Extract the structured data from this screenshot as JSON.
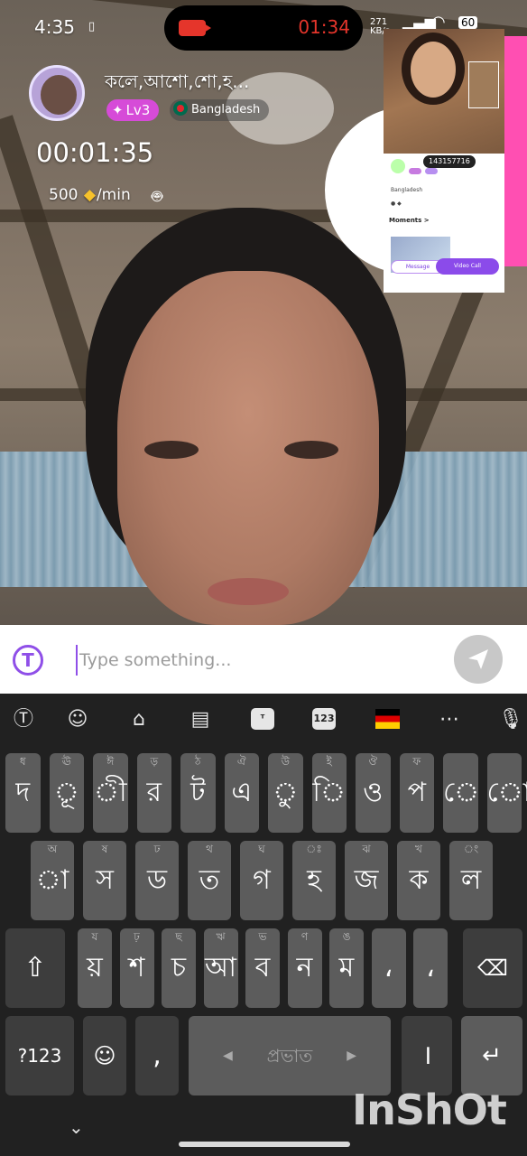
{
  "status_bar": {
    "time": "4:35",
    "network_speed": "271 KB/s",
    "battery": "60"
  },
  "call": {
    "timer": "01:34",
    "caller_name": "কলে,আশো,শো,হ...",
    "level": "Lv3",
    "country": "Bangladesh",
    "duration": "00:01:35",
    "rate_amount": "500",
    "rate_unit": "/min"
  },
  "pip": {
    "user_id": "143157716",
    "country": "Bangladesh",
    "moments_label": "Moments >",
    "message_label": "Message",
    "video_call_label": "Video Call"
  },
  "input": {
    "placeholder": "Type something..."
  },
  "keyboard": {
    "toolbar": [
      "translate-icon",
      "emoji-icon",
      "store-icon",
      "clipboard-icon",
      "theme-icon",
      "numbers-icon",
      "germany-flag-icon",
      "more-icon",
      "mic-icon"
    ],
    "row1": [
      {
        "main": "দ",
        "hint": "ধ"
      },
      {
        "main": "ূ",
        "hint": "ঊ"
      },
      {
        "main": "ী",
        "hint": "ঈ"
      },
      {
        "main": "র",
        "hint": "ড়"
      },
      {
        "main": "ট",
        "hint": "ঠ"
      },
      {
        "main": "এ",
        "hint": "ঐ"
      },
      {
        "main": "ু",
        "hint": "উ"
      },
      {
        "main": "ি",
        "hint": "ই"
      },
      {
        "main": "ও",
        "hint": "ঔ"
      },
      {
        "main": "প",
        "hint": "ফ"
      },
      {
        "main": "ে",
        "hint": ""
      },
      {
        "main": "ো",
        "hint": ""
      }
    ],
    "row2": [
      {
        "main": "া",
        "hint": "অ"
      },
      {
        "main": "স",
        "hint": "ষ"
      },
      {
        "main": "ড",
        "hint": "ঢ"
      },
      {
        "main": "ত",
        "hint": "থ"
      },
      {
        "main": "গ",
        "hint": "ঘ"
      },
      {
        "main": "হ",
        "hint": "ঃ"
      },
      {
        "main": "জ",
        "hint": "ঝ"
      },
      {
        "main": "ক",
        "hint": "খ"
      },
      {
        "main": "ল",
        "hint": "ং"
      }
    ],
    "row3": [
      {
        "main": "য়",
        "hint": "য"
      },
      {
        "main": "শ",
        "hint": "ঢ়"
      },
      {
        "main": "চ",
        "hint": "ছ"
      },
      {
        "main": "আ",
        "hint": "ঋ"
      },
      {
        "main": "ব",
        "hint": "ভ"
      },
      {
        "main": "ন",
        "hint": "ণ"
      },
      {
        "main": "ম",
        "hint": "ঙ"
      },
      {
        "main": "،",
        "hint": ""
      },
      {
        "main": "،",
        "hint": ""
      }
    ],
    "numbers_label": "?123",
    "comma": ",",
    "space_label": "প্রভাত",
    "danda": "।"
  },
  "watermark": "InShOt",
  "colors": {
    "accent_purple": "#8f4fe8",
    "call_red": "#e5352b",
    "level_pink": "#d64bd8",
    "pip_pink": "#ff4fb2"
  }
}
